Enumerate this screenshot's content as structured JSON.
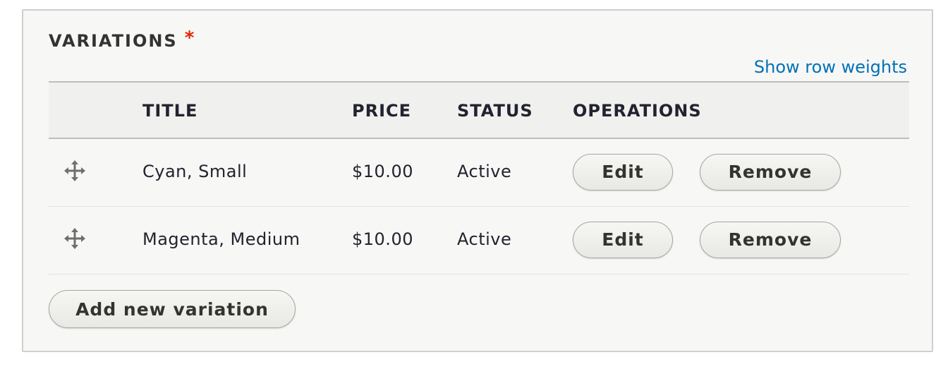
{
  "fieldset": {
    "legend": "VARIATIONS",
    "required_mark": "*",
    "show_row_weights": "Show row weights"
  },
  "table": {
    "headers": [
      "TITLE",
      "PRICE",
      "STATUS",
      "OPERATIONS"
    ],
    "rows": [
      {
        "title": "Cyan, Small",
        "price": "$10.00",
        "status": "Active",
        "edit": "Edit",
        "remove": "Remove",
        "drag_icon": "move-arrows-icon"
      },
      {
        "title": "Magenta, Medium",
        "price": "$10.00",
        "status": "Active",
        "edit": "Edit",
        "remove": "Remove",
        "drag_icon": "move-arrows-icon"
      }
    ]
  },
  "add_button": "Add new variation",
  "colors": {
    "link": "#0071b8",
    "required": "#e32700",
    "background": "#f7f7f5",
    "header_background": "#f0f0ee"
  }
}
